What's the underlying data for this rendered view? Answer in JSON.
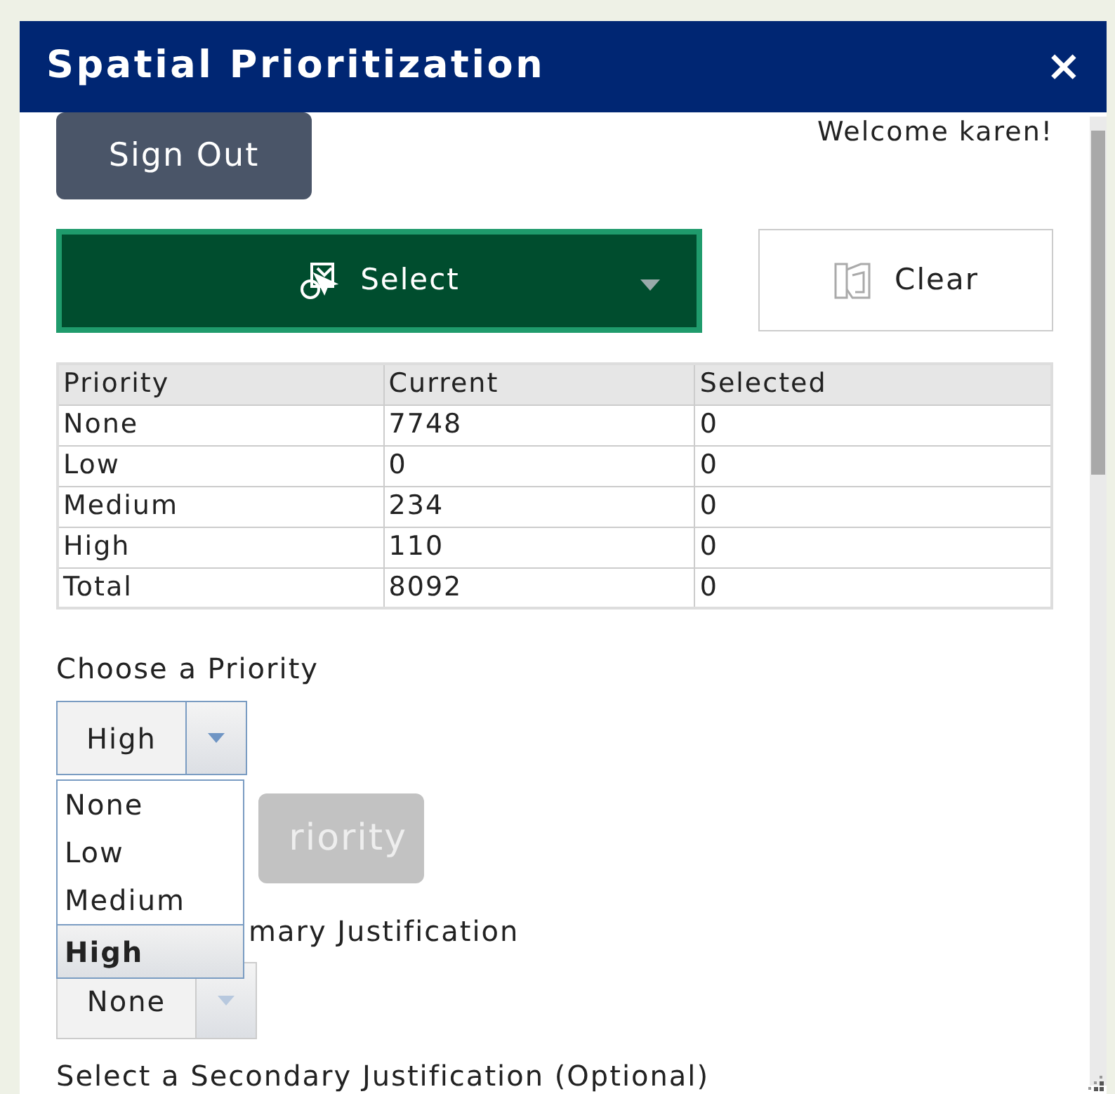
{
  "window": {
    "title": "Spatial Prioritization",
    "close": "×"
  },
  "sign_out": "Sign Out",
  "welcome": "Welcome karen!",
  "select_button": {
    "label": "Select"
  },
  "clear_button": {
    "label": "Clear"
  },
  "table": {
    "columns": [
      "Priority",
      "Current",
      "Selected"
    ],
    "rows": [
      [
        "None",
        "7748",
        "0"
      ],
      [
        "Low",
        "0",
        "0"
      ],
      [
        "Medium",
        "234",
        "0"
      ],
      [
        "High",
        "110",
        "0"
      ],
      [
        "Total",
        "8092",
        "0"
      ]
    ]
  },
  "priority": {
    "label": "Choose a Priority",
    "value": "High",
    "expanded": true,
    "options": [
      {
        "label": "None",
        "selected": false
      },
      {
        "label": "Low",
        "selected": false
      },
      {
        "label": "Medium",
        "selected": false
      },
      {
        "label": "High",
        "selected": true
      }
    ]
  },
  "set_priority_button": {
    "label": "riority",
    "disabled": true
  },
  "primary_justification": {
    "label": "mary Justification",
    "value": "None"
  },
  "secondary_justification": {
    "label": "Select a Secondary Justification (Optional)"
  }
}
